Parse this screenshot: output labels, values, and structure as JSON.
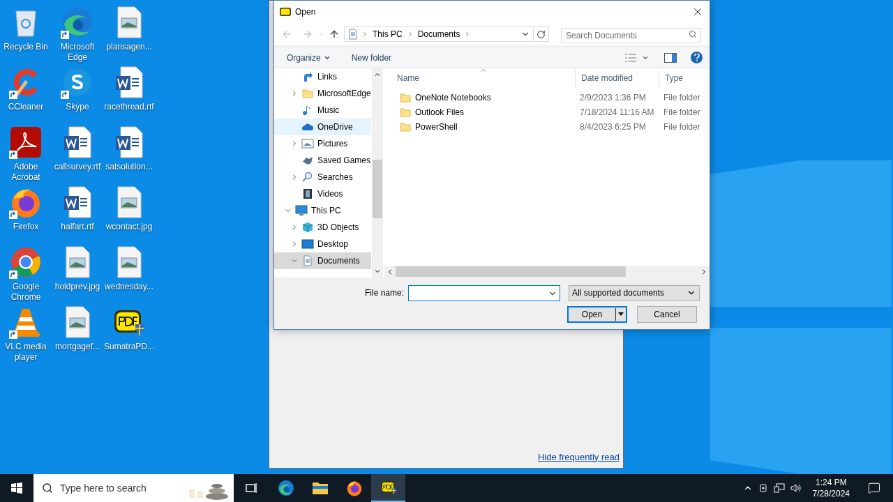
{
  "desktop_icons": [
    {
      "label": "Recycle Bin",
      "kind": "recycle",
      "shortcut": false
    },
    {
      "label": "CCleaner",
      "kind": "ccleaner",
      "shortcut": true
    },
    {
      "label": "Adobe Acrobat",
      "kind": "acrobat",
      "shortcut": true
    },
    {
      "label": "Firefox",
      "kind": "firefox",
      "shortcut": true
    },
    {
      "label": "Google Chrome",
      "kind": "chrome",
      "shortcut": true
    },
    {
      "label": "VLC media player",
      "kind": "vlc",
      "shortcut": true
    },
    {
      "label": "Microsoft Edge",
      "kind": "edge",
      "shortcut": true
    },
    {
      "label": "Skype",
      "kind": "skype",
      "shortcut": true
    },
    {
      "label": "callsurvey.rtf",
      "kind": "word",
      "shortcut": false
    },
    {
      "label": "halfart.rtf",
      "kind": "word",
      "shortcut": false
    },
    {
      "label": "holdprev.jpg",
      "kind": "image",
      "shortcut": false
    },
    {
      "label": "mortgagef...",
      "kind": "image",
      "shortcut": false
    },
    {
      "label": "plansagen...",
      "kind": "image",
      "shortcut": false
    },
    {
      "label": "racethread.rtf",
      "kind": "word",
      "shortcut": false
    },
    {
      "label": "satsolution...",
      "kind": "word",
      "shortcut": false
    },
    {
      "label": "wcontact.jpg",
      "kind": "image",
      "shortcut": false
    },
    {
      "label": "wednesday...",
      "kind": "image",
      "shortcut": false
    },
    {
      "label": "SumatraPD...",
      "kind": "sumatra",
      "shortcut": false
    }
  ],
  "background_window": {
    "link": "Hide frequently read"
  },
  "dialog": {
    "title": "Open",
    "nav": {
      "back_disabled": true,
      "forward_disabled": true
    },
    "breadcrumb": [
      "This PC",
      "Documents"
    ],
    "search": {
      "placeholder": "Search Documents"
    },
    "organize": "Organize",
    "new_folder": "New folder",
    "tree": {
      "items": [
        {
          "label": "Links",
          "kind": "links",
          "expandable": false,
          "hovered": false,
          "selected": false
        },
        {
          "label": "MicrosoftEdge",
          "kind": "folder",
          "expandable": true,
          "expanded": false,
          "hovered": false,
          "selected": false
        },
        {
          "label": "Music",
          "kind": "music",
          "expandable": false,
          "hovered": false,
          "selected": false
        },
        {
          "label": "OneDrive",
          "kind": "cloud",
          "expandable": false,
          "hovered": true,
          "selected": false
        },
        {
          "label": "Pictures",
          "kind": "pictures",
          "expandable": true,
          "expanded": false,
          "hovered": false,
          "selected": false
        },
        {
          "label": "Saved Games",
          "kind": "games",
          "expandable": false,
          "hovered": false,
          "selected": false
        },
        {
          "label": "Searches",
          "kind": "search",
          "expandable": true,
          "expanded": false,
          "hovered": false,
          "selected": false
        },
        {
          "label": "Videos",
          "kind": "videos",
          "expandable": false,
          "hovered": false,
          "selected": false
        }
      ],
      "roots": [
        {
          "label": "This PC",
          "kind": "pc",
          "expandable": true,
          "expanded": true,
          "hovered": false,
          "selected": false,
          "children": [
            {
              "label": "3D Objects",
              "kind": "cube",
              "expandable": true,
              "expanded": false,
              "hovered": false,
              "selected": false
            },
            {
              "label": "Desktop",
              "kind": "desktop",
              "expandable": true,
              "expanded": false,
              "hovered": false,
              "selected": false
            },
            {
              "label": "Documents",
              "kind": "document",
              "expandable": true,
              "expanded": true,
              "hovered": false,
              "selected": true
            }
          ]
        }
      ]
    },
    "columns": [
      "Name",
      "Date modified",
      "Type"
    ],
    "files": [
      {
        "name": "OneNote Notebooks",
        "date": "2/9/2023 1:36 PM",
        "type": "File folder"
      },
      {
        "name": "Outlook Files",
        "date": "7/18/2024 11:16 AM",
        "type": "File folder"
      },
      {
        "name": "PowerShell",
        "date": "8/4/2023 6:25 PM",
        "type": "File folder"
      }
    ],
    "file_name_label": "File name:",
    "filter": "All supported documents",
    "open": "Open",
    "cancel": "Cancel"
  },
  "taskbar": {
    "search_placeholder": "Type here to search",
    "apps": [
      {
        "kind": "task-view",
        "active": false
      },
      {
        "kind": "edge",
        "active": false
      },
      {
        "kind": "explorer",
        "active": false
      },
      {
        "kind": "firefox",
        "active": false
      },
      {
        "kind": "sumatra",
        "active": true
      }
    ],
    "time": "1:24 PM",
    "date": "7/28/2024"
  }
}
